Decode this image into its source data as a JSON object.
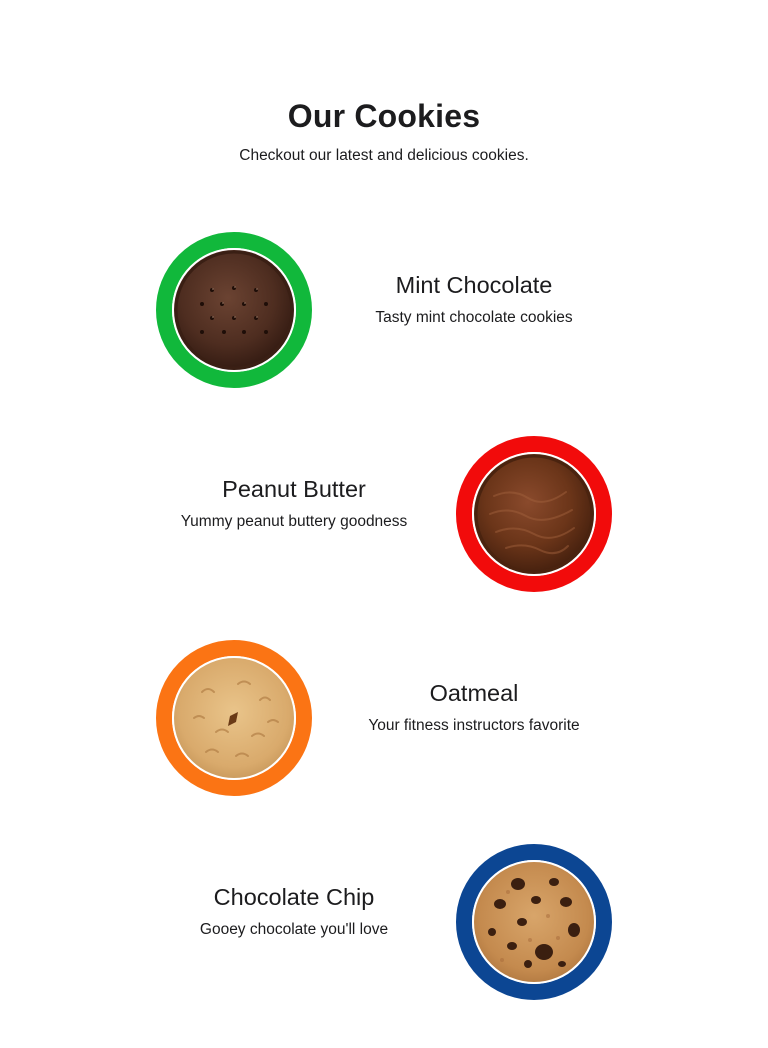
{
  "header": {
    "title": "Our Cookies",
    "subtitle": "Checkout our latest and delicious cookies."
  },
  "cookies": [
    {
      "name": "Mint Chocolate",
      "description": "Tasty mint chocolate cookies",
      "ring_color": "#11b83b",
      "image_icon": "mint-chocolate-cookie-icon"
    },
    {
      "name": "Peanut Butter",
      "description": "Yummy peanut buttery goodness",
      "ring_color": "#f20b0b",
      "image_icon": "peanut-butter-cookie-icon"
    },
    {
      "name": "Oatmeal",
      "description": "Your fitness instructors favorite",
      "ring_color": "#fb7414",
      "image_icon": "oatmeal-cookie-icon"
    },
    {
      "name": "Chocolate Chip",
      "description": "Gooey chocolate you'll love",
      "ring_color": "#0c4693",
      "image_icon": "chocolate-chip-cookie-icon"
    }
  ]
}
